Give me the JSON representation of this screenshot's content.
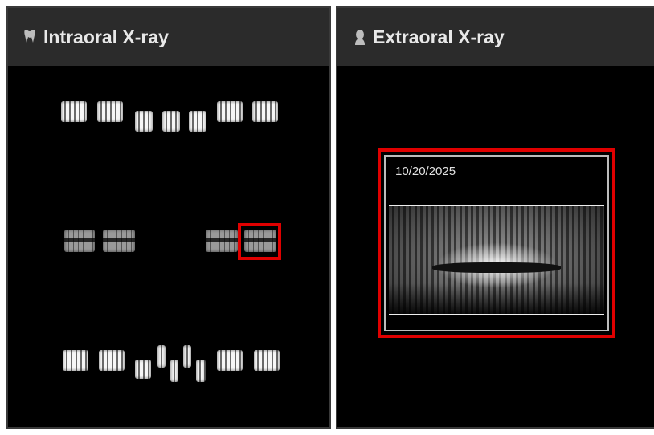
{
  "intraoral": {
    "title": "Intraoral X-ray",
    "icon": "tooth-icon"
  },
  "extraoral": {
    "title": "Extraoral X-ray",
    "icon": "person-icon",
    "image": {
      "date": "10/20/2025"
    }
  },
  "colors": {
    "selection": "#e00000",
    "header_bg": "#2b2b2b",
    "panel_bg": "#000000"
  }
}
